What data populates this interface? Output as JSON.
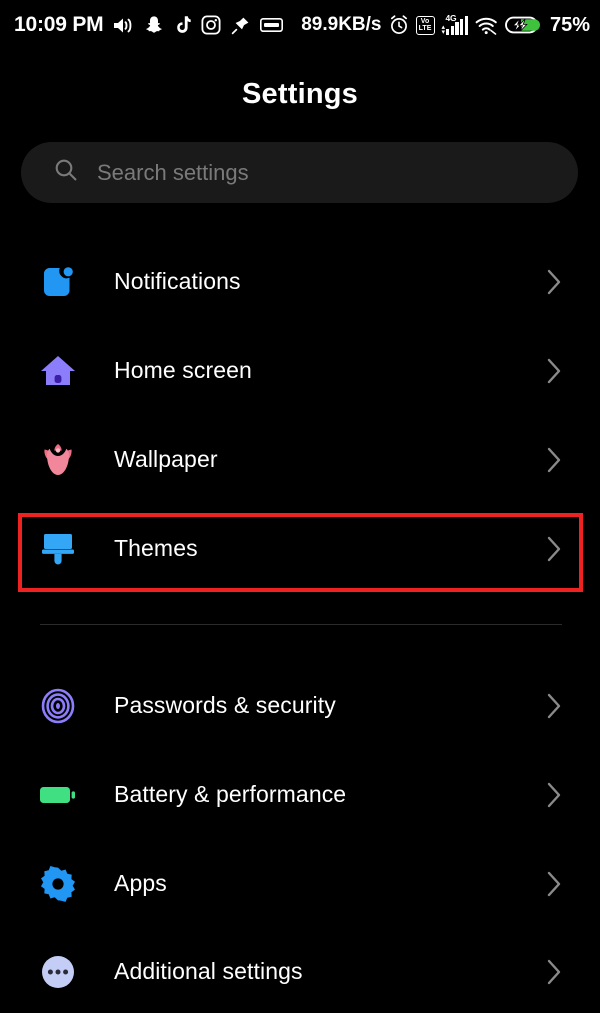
{
  "status_bar": {
    "time": "10:09 PM",
    "network_speed": "89.9KB/s",
    "battery_percent": "75%",
    "volte_top": "Vo",
    "volte_bottom": "LTE",
    "network_type": "4G",
    "icons": [
      "volume-icon",
      "snapchat-icon",
      "tiktok-icon",
      "instagram-icon",
      "pin-icon",
      "messenger-icon",
      "alarm-icon",
      "volte-icon",
      "signal-icon",
      "wifi-icon",
      "battery-charging-icon"
    ]
  },
  "header": {
    "title": "Settings"
  },
  "search": {
    "placeholder": "Search settings",
    "value": "",
    "icon": "search-icon"
  },
  "highlight": {
    "color": "#ef2222",
    "target": "Themes"
  },
  "groups": [
    {
      "id": "personalization",
      "items": [
        {
          "label": "Notifications",
          "icon": "notifications-icon",
          "icon_color": "#2196f3",
          "highlighted": false
        },
        {
          "label": "Home screen",
          "icon": "home-icon",
          "icon_color": "#8c7dfa",
          "highlighted": false
        },
        {
          "label": "Wallpaper",
          "icon": "flower-icon",
          "icon_color": "#ef6e86",
          "highlighted": false
        },
        {
          "label": "Themes",
          "icon": "paintbrush-icon",
          "icon_color": "#33a6f5",
          "highlighted": true
        }
      ]
    },
    {
      "id": "system",
      "items": [
        {
          "label": "Passwords & security",
          "icon": "fingerprint-icon",
          "icon_color": "#8c7dfa",
          "highlighted": false
        },
        {
          "label": "Battery & performance",
          "icon": "battery-icon",
          "icon_color": "#40df82",
          "highlighted": false
        },
        {
          "label": "Apps",
          "icon": "gear-icon",
          "icon_color": "#2196f3",
          "highlighted": false
        },
        {
          "label": "Additional settings",
          "icon": "ellipsis-icon",
          "icon_color": "#c3cdf5",
          "highlighted": false
        }
      ]
    }
  ],
  "chevron_icon": "chevron-right-icon"
}
